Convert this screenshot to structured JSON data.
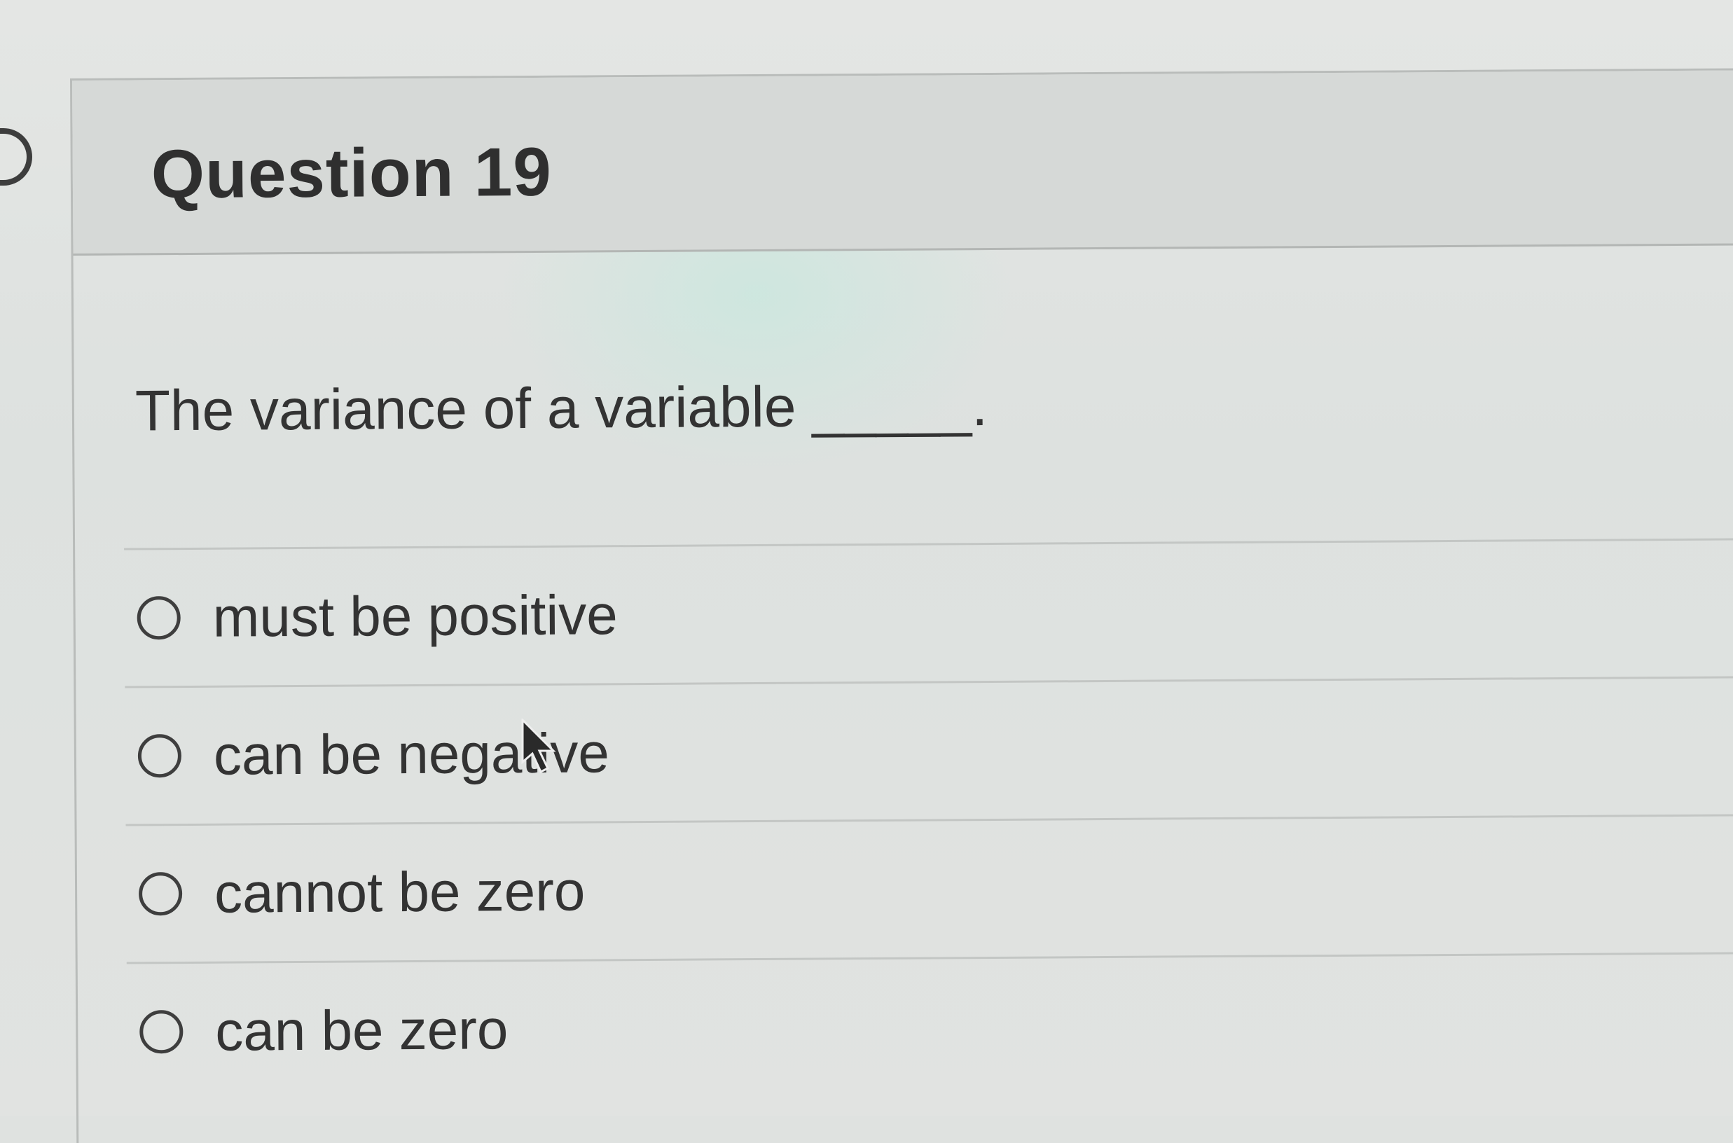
{
  "question": {
    "title": "Question 19",
    "text": "The variance of a variable _____."
  },
  "answers": [
    {
      "label": "must be positive",
      "selected": false
    },
    {
      "label": "can be negative",
      "selected": false
    },
    {
      "label": "cannot be zero",
      "selected": false
    },
    {
      "label": "can be zero",
      "selected": false
    }
  ],
  "icons": {
    "panel_toggle": "panel-toggle-icon",
    "radio": "radio-unchecked-icon",
    "cursor": "mouse-pointer-icon"
  }
}
